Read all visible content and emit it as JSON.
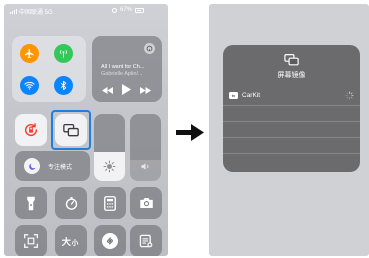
{
  "left_phone": {
    "status_bar": {
      "carrier": "中国联通 5G",
      "battery": "67%"
    },
    "now_playing": {
      "title": "All I want for Ch...",
      "artist": "Gabrielle Aplin/..."
    },
    "focus_label": "专注模式"
  },
  "right_phone": {
    "screen_mirroring": {
      "title": "屏幕镜像",
      "device_badge": "tv",
      "device_name": "CarKit"
    }
  },
  "colors": {
    "airplane_orange": "#ff9500",
    "cellular_green": "#34c759",
    "connectivity_blue": "#0a84ff",
    "lock_red": "#ff3b30",
    "highlight_blue": "#1e7fe0"
  }
}
